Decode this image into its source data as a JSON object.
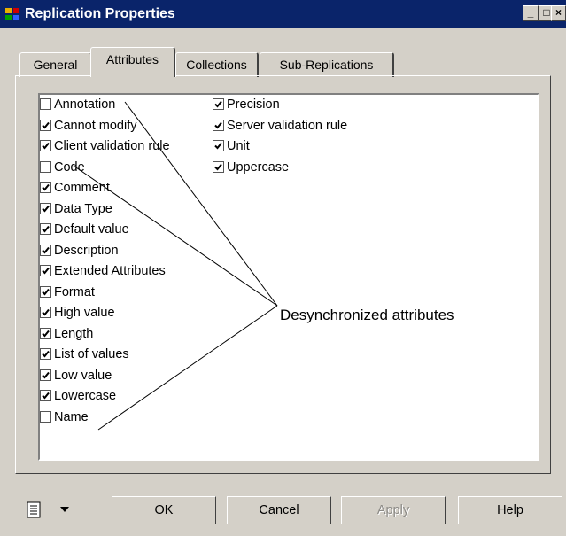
{
  "window": {
    "title": "Replication Properties",
    "minimize": "_",
    "maximize": "□",
    "close": "×"
  },
  "tabs": [
    {
      "label": "General",
      "active": false
    },
    {
      "label": "Attributes",
      "active": true
    },
    {
      "label": "Collections",
      "active": false
    },
    {
      "label": "Sub-Replications",
      "active": false
    }
  ],
  "attributes_left": [
    {
      "label": "Annotation",
      "checked": false
    },
    {
      "label": "Cannot modify",
      "checked": true
    },
    {
      "label": "Client validation rule",
      "checked": true
    },
    {
      "label": "Code",
      "checked": false
    },
    {
      "label": "Comment",
      "checked": true
    },
    {
      "label": "Data Type",
      "checked": true
    },
    {
      "label": "Default value",
      "checked": true
    },
    {
      "label": "Description",
      "checked": true
    },
    {
      "label": "Extended Attributes",
      "checked": true
    },
    {
      "label": "Format",
      "checked": true
    },
    {
      "label": "High value",
      "checked": true
    },
    {
      "label": "Length",
      "checked": true
    },
    {
      "label": "List of values",
      "checked": true
    },
    {
      "label": "Low value",
      "checked": true
    },
    {
      "label": "Lowercase",
      "checked": true
    },
    {
      "label": "Name",
      "checked": false
    }
  ],
  "attributes_right": [
    {
      "label": "Precision",
      "checked": true
    },
    {
      "label": "Server validation rule",
      "checked": true
    },
    {
      "label": "Unit",
      "checked": true
    },
    {
      "label": "Uppercase",
      "checked": true
    }
  ],
  "callout": "Desynchronized attributes",
  "buttons": {
    "ok": "OK",
    "cancel": "Cancel",
    "apply": "Apply",
    "help": "Help"
  },
  "icons": {
    "app": "replication-icon",
    "menu": "property-menu-icon",
    "dropdown": "dropdown-arrow-icon"
  }
}
